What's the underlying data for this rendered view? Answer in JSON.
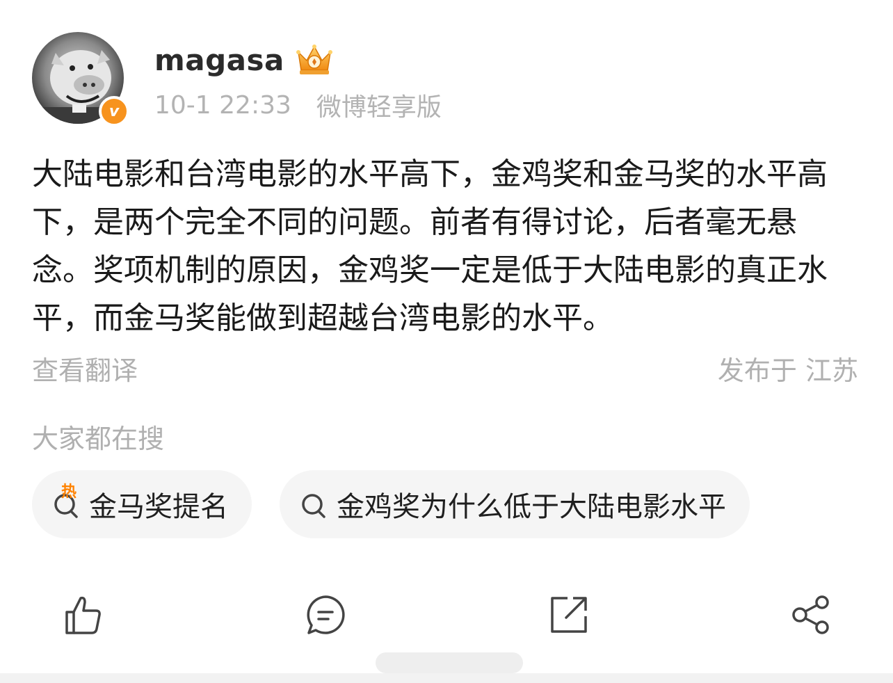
{
  "post": {
    "username": "magasa",
    "time": "10-1 22:33",
    "source": "微博轻享版",
    "content": "大陆电影和台湾电影的水平高下，金鸡奖和金马奖的水平高下，是两个完全不同的问题。前者有得讨论，后者毫无悬念。奖项机制的原因，金鸡奖一定是低于大陆电影的真正水平，而金马奖能做到超越台湾电影的水平。",
    "translate_label": "查看翻译",
    "location_label": "发布于 江苏",
    "badge_letter": "v"
  },
  "search": {
    "title": "大家都在搜",
    "chips": [
      {
        "label": "金马奖提名",
        "tag": "热",
        "icon": "search-icon"
      },
      {
        "label": "金鸡奖为什么低于大陆电影水平",
        "icon": "search-icon"
      }
    ]
  },
  "actions": {
    "icons": [
      "thumbs-up-icon",
      "comment-icon",
      "repost-icon",
      "share-icon"
    ]
  },
  "colors": {
    "text": "#1a1a1a",
    "muted": "#b0b0b0",
    "badge": "#f7931e",
    "hot": "#ff8200",
    "chip_bg": "#f5f5f5",
    "icon": "#444444"
  }
}
